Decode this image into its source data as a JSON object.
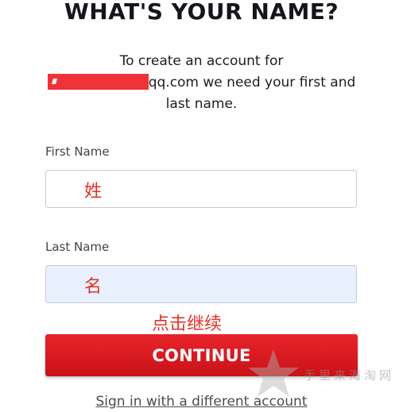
{
  "page": {
    "heading": "WHAT'S YOUR NAME?",
    "subtitle_line1": "To create an account for",
    "email_visible_suffix": "qq.com",
    "subtitle_line2_rest": " we need your first and",
    "subtitle_line3": "last name."
  },
  "form": {
    "first_name": {
      "label": "First Name",
      "value": "姓"
    },
    "last_name": {
      "label": "Last Name",
      "value": "名"
    },
    "annotation": "点击继续",
    "continue_label": "CONTINUE",
    "signin_link": "Sign in with a different account"
  },
  "watermark": {
    "text": "手里来海淘网",
    "icon": "star-icon"
  },
  "colors": {
    "accent_red": "#d71920",
    "redaction_red": "#f03338",
    "annotation_red": "#e2322b",
    "autofill_blue": "#e9f0fe"
  }
}
